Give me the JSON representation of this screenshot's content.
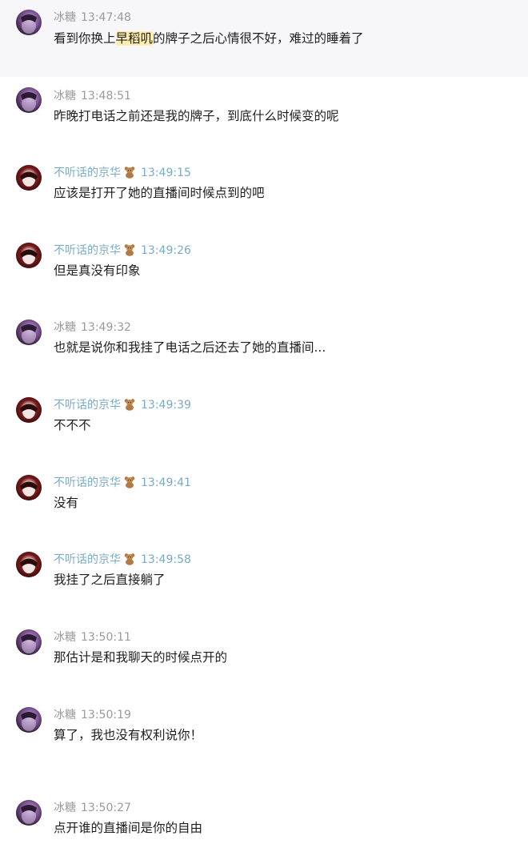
{
  "messages": [
    {
      "sender": "冰糖",
      "time": "13:47:48",
      "text_before": "看到你换上",
      "text_highlight": "早稻叽",
      "text_after": "的牌子之后心情很不好，难过的睡着了",
      "highlighted": true
    },
    {
      "sender": "冰糖",
      "time": "13:48:51",
      "text": "昨晚打电话之前还是我的牌子，到底什么时候变的呢"
    },
    {
      "sender": "不听话的京华",
      "time": "13:49:15",
      "text": "应该是打开了她的直播间时候点到的吧"
    },
    {
      "sender": "不听话的京华",
      "time": "13:49:26",
      "text": "但是真没有印象"
    },
    {
      "sender": "冰糖",
      "time": "13:49:32",
      "text": "也就是说你和我挂了电话之后还去了她的直播间..."
    },
    {
      "sender": "不听话的京华",
      "time": "13:49:39",
      "text": "不不不"
    },
    {
      "sender": "不听话的京华",
      "time": "13:49:41",
      "text": "没有"
    },
    {
      "sender": "不听话的京华",
      "time": "13:49:58",
      "text": "我挂了之后直接躺了"
    },
    {
      "sender": "冰糖",
      "time": "13:50:11",
      "text": "那估计是和我聊天的时候点开的"
    },
    {
      "sender": "冰糖",
      "time": "13:50:19",
      "text": "算了，我也没有权利说你！"
    },
    {
      "sender": "冰糖",
      "time": "13:50:27",
      "text": "点开谁的直播间是你的自由"
    }
  ],
  "icons": {
    "jinghua_badge": "teddy-bear-icon"
  },
  "colors": {
    "grey_meta": "#9a9a9a",
    "blue_meta": "#79aac8",
    "highlight": "#fdeeb0",
    "highlight_row_bg": "#f7f7f9"
  }
}
